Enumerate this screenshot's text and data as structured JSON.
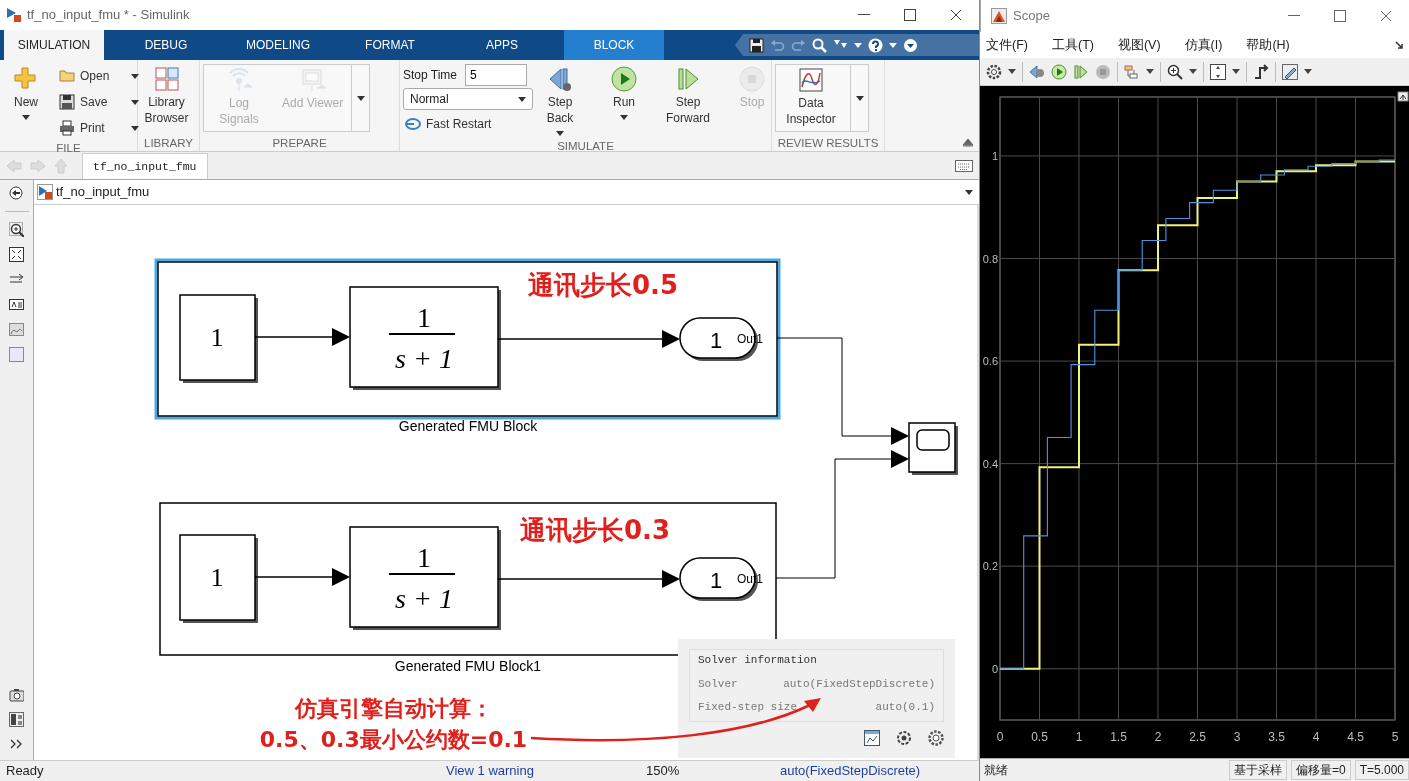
{
  "window": {
    "title": "tf_no_input_fmu * - Simulink"
  },
  "ribbon_tabs": [
    {
      "label": "SIMULATION",
      "selected": true,
      "kind": "main"
    },
    {
      "label": "DEBUG",
      "selected": false,
      "kind": "main"
    },
    {
      "label": "MODELING",
      "selected": false,
      "kind": "main"
    },
    {
      "label": "FORMAT",
      "selected": false,
      "kind": "main"
    },
    {
      "label": "APPS",
      "selected": false,
      "kind": "main"
    },
    {
      "label": "BLOCK",
      "selected": false,
      "kind": "contextual"
    }
  ],
  "ribbon": [
    {
      "label": "FILE",
      "items": [
        {
          "kind": "large",
          "label": "New",
          "disabled": false,
          "dropdown": true
        },
        {
          "kind": "small",
          "label": "Open",
          "disabled": false,
          "dropdown": true
        },
        {
          "kind": "small",
          "label": "Save",
          "disabled": false,
          "dropdown": true
        },
        {
          "kind": "small",
          "label": "Print",
          "disabled": false,
          "dropdown": true
        }
      ]
    },
    {
      "label": "LIBRARY",
      "items": [
        {
          "kind": "large",
          "label": "Library Browser",
          "disabled": false
        }
      ]
    },
    {
      "label": "PREPARE",
      "gallery": true,
      "items": [
        {
          "kind": "large",
          "label": "Log Signals",
          "disabled": true
        },
        {
          "kind": "large",
          "label": "Add Viewer",
          "disabled": true
        }
      ]
    },
    {
      "label": "SIMULATE",
      "items": [
        {
          "kind": "field",
          "label": "Stop Time",
          "value": "5"
        },
        {
          "kind": "select",
          "value": "Normal"
        },
        {
          "kind": "small",
          "label": "Fast Restart",
          "disabled": false
        },
        {
          "kind": "large",
          "label": "Step Back",
          "disabled": false,
          "dropdown": true
        },
        {
          "kind": "large",
          "label": "Run",
          "disabled": false,
          "dropdown": true
        },
        {
          "kind": "large",
          "label": "Step Forward",
          "disabled": false
        },
        {
          "kind": "large",
          "label": "Stop",
          "disabled": true
        }
      ]
    },
    {
      "label": "REVIEW RESULTS",
      "gallery": true,
      "items": [
        {
          "kind": "large",
          "label": "Data Inspector",
          "disabled": false
        }
      ]
    }
  ],
  "breadcrumb": "tf_no_input_fmu",
  "address": "tf_no_input_fmu",
  "subsystems": [
    {
      "name": "Generated FMU Block",
      "selected": true,
      "constant": "1",
      "numerator": "1",
      "denominator": "s + 1",
      "outport": "1",
      "port_label": "Out1"
    },
    {
      "name": "Generated FMU Block1",
      "selected": false,
      "constant": "1",
      "numerator": "1",
      "denominator": "s + 1",
      "outport": "1",
      "port_label": "Out1"
    }
  ],
  "annotations": [
    {
      "lines": [
        "通讯步长0.5"
      ]
    },
    {
      "lines": [
        "通讯步长0.3"
      ]
    },
    {
      "lines": [
        "仿真引擎自动计算：",
        "0.5、0.3最小公约数=0.1"
      ]
    }
  ],
  "solver_info": {
    "title": "Solver information",
    "rows": [
      {
        "label": "Solver",
        "value": "auto(FixedStepDiscrete)"
      },
      {
        "label": "Fixed-step size",
        "value": "auto(0.1)"
      }
    ]
  },
  "status_bar": {
    "state": "Ready",
    "warning": "View 1 warning",
    "zoom": "150%",
    "solver": "auto(FixedStepDiscrete)"
  },
  "scope": {
    "title": "Scope",
    "menu": [
      "文件(F)",
      "工具(T)",
      "视图(V)",
      "仿真(I)",
      "帮助(H)"
    ],
    "chart_data": {
      "type": "line",
      "grid": true,
      "xlim": [
        0,
        5
      ],
      "ylim": [
        -0.1,
        1.115
      ],
      "xticks": [
        0,
        0.5,
        1,
        1.5,
        2,
        2.5,
        3,
        3.5,
        4,
        4.5,
        5
      ],
      "yticks": [
        0,
        0.2,
        0.4,
        0.6,
        0.8,
        1
      ],
      "series": [
        {
          "color": "#f2f27a",
          "x": [
            0,
            0.5,
            0.5,
            1,
            1,
            1.5,
            1.5,
            2,
            2,
            2.5,
            2.5,
            3,
            3,
            3.5,
            3.5,
            4,
            4,
            4.5,
            4.5,
            5
          ],
          "values": [
            0,
            0,
            0.393,
            0.393,
            0.632,
            0.632,
            0.777,
            0.777,
            0.865,
            0.865,
            0.918,
            0.918,
            0.95,
            0.95,
            0.97,
            0.97,
            0.982,
            0.982,
            0.989,
            0.989
          ]
        },
        {
          "color": "#4f94e0",
          "x": [
            0,
            0.3,
            0.3,
            0.6,
            0.6,
            0.9,
            0.9,
            1.2,
            1.2,
            1.5,
            1.5,
            1.8,
            1.8,
            2.1,
            2.1,
            2.4,
            2.4,
            2.7,
            2.7,
            3,
            3,
            3.3,
            3.3,
            3.6,
            3.6,
            3.9,
            3.9,
            4.2,
            4.2,
            4.5,
            4.5,
            4.8,
            4.8,
            5
          ],
          "values": [
            0,
            0,
            0.259,
            0.259,
            0.451,
            0.451,
            0.593,
            0.593,
            0.699,
            0.699,
            0.777,
            0.777,
            0.835,
            0.835,
            0.878,
            0.878,
            0.909,
            0.909,
            0.933,
            0.933,
            0.95,
            0.95,
            0.963,
            0.963,
            0.973,
            0.973,
            0.98,
            0.98,
            0.985,
            0.985,
            0.989,
            0.989,
            0.992,
            0.992
          ]
        }
      ]
    },
    "status": [
      "就绪",
      "基于采样",
      "偏移量=0",
      "T=5.000"
    ]
  }
}
